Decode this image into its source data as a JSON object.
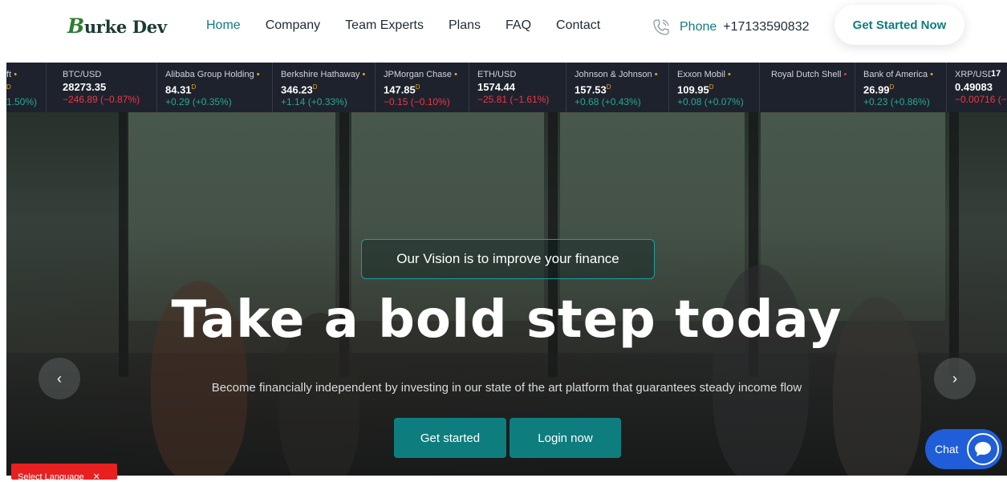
{
  "header": {
    "logo": "Burke Dev",
    "nav": [
      "Home",
      "Company",
      "Team Experts",
      "Plans",
      "FAQ",
      "Contact"
    ],
    "phone_label": "Phone",
    "phone_number": "+17133590832",
    "cta": "Get Started Now"
  },
  "ticker": [
    {
      "name": "ft",
      "price": "",
      "change": "1.50%)",
      "dir": "up",
      "delayed": "D"
    },
    {
      "name": "BTC/USD",
      "price": "28273.35",
      "change": "−246.89 (−0.87%)",
      "dir": "down",
      "delayed": ""
    },
    {
      "name": "Alibaba Group Holding",
      "price": "84.31",
      "change": "+0.29 (+0.35%)",
      "dir": "up",
      "delayed": "D"
    },
    {
      "name": "Berkshire Hathaway",
      "price": "346.23",
      "change": "+1.14 (+0.33%)",
      "dir": "up",
      "delayed": "D"
    },
    {
      "name": "JPMorgan Chase",
      "price": "147.85",
      "change": "−0.15 (−0.10%)",
      "dir": "down",
      "delayed": "D"
    },
    {
      "name": "ETH/USD",
      "price": "1574.44",
      "change": "−25.81 (−1.61%)",
      "dir": "down",
      "delayed": ""
    },
    {
      "name": "Johnson & Johnson",
      "price": "157.53",
      "change": "+0.68 (+0.43%)",
      "dir": "up",
      "delayed": "D"
    },
    {
      "name": "Exxon Mobil",
      "price": "109.95",
      "change": "+0.08 (+0.07%)",
      "dir": "up",
      "delayed": "D"
    },
    {
      "name": "Royal Dutch Shell",
      "price": "",
      "change": "",
      "dir": "up",
      "delayed": ""
    },
    {
      "name": "Bank of America",
      "price": "26.99",
      "change": "+0.23 (+0.86%)",
      "dir": "up",
      "delayed": "D"
    },
    {
      "name": "XRP/USD",
      "price": "0.49083",
      "change": "−0.00716 (−",
      "dir": "down",
      "delayed": ""
    }
  ],
  "hero": {
    "vision": "Our Vision is to improve your finance",
    "headline": "Take a bold step today",
    "subline": "Become financially independent by investing in our state of the art platform that guarantees steady income flow",
    "btn_start": "Get started",
    "btn_login": "Login now",
    "arrow_left": "‹",
    "arrow_right": "›"
  },
  "chat": {
    "label": "Chat"
  },
  "language": {
    "label": "Select Language",
    "close": "✕"
  },
  "colors": {
    "accent": "#0e7d7e",
    "ticker_bg": "#1e222d",
    "up": "#22ab94",
    "down": "#f23645",
    "chat": "#1f5ed8",
    "lang": "#e82020"
  }
}
